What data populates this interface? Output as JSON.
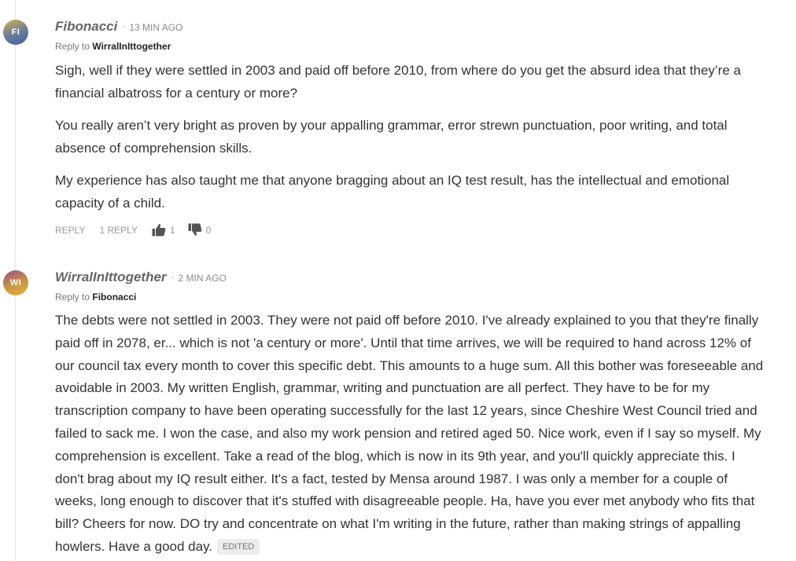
{
  "comments": [
    {
      "avatar_initials": "FI",
      "author": "Fibonacci",
      "separator": "·",
      "time": "13 MIN AGO",
      "reply_to_prefix": "Reply to",
      "reply_to_name": "WirralInIttogether",
      "paragraphs": [
        "Sigh, well if they were settled in 2003 and paid off before 2010, from where do you get the absurd idea that they’re a financial albatross for a century or more?",
        "You really aren’t very bright as proven by your appalling grammar, error strewn punctuation, poor writing, and total absence of comprehension skills.",
        "My experience has also taught me that anyone bragging about an IQ test result, has the intellectual and emotional capacity of a child."
      ],
      "actions": {
        "reply_label": "REPLY",
        "replies_label": "1 REPLY",
        "upvotes": "1",
        "downvotes": "0"
      }
    },
    {
      "avatar_initials": "WI",
      "author": "WirralInIttogether",
      "separator": "·",
      "time": "2 MIN AGO",
      "reply_to_prefix": "Reply to",
      "reply_to_name": "Fibonacci",
      "paragraphs": [
        "The debts were not settled in 2003. They were not paid off before 2010. I've already explained to you that they're finally paid off in 2078, er... which is not 'a century or more'. Until that time arrives, we will be required to hand across 12% of our council tax every month to cover this specific debt. This amounts to a huge sum. All this bother was foreseeable and avoidable in 2003. My written English, grammar, writing and punctuation are all perfect. They have to be for my transcription company to have been operating successfully for the last 12 years, since Cheshire West Council tried and failed to sack me. I won the case, and also my work pension and retired aged 50. Nice work, even if I say so myself. My comprehension is excellent. Take a read of the blog, which is now in its 9th year, and you'll quickly appreciate this. I don't brag about my IQ result either. It's a fact, tested by Mensa around 1987. I was only a member for a couple of weeks, long enough to discover that it's stuffed with disagreeable people. Ha, have you ever met anybody who fits that bill? Cheers for now. DO try and concentrate on what I'm writing in the future, rather than making strings of appalling howlers. Have a good day."
      ],
      "edited_label": "EDITED"
    }
  ]
}
